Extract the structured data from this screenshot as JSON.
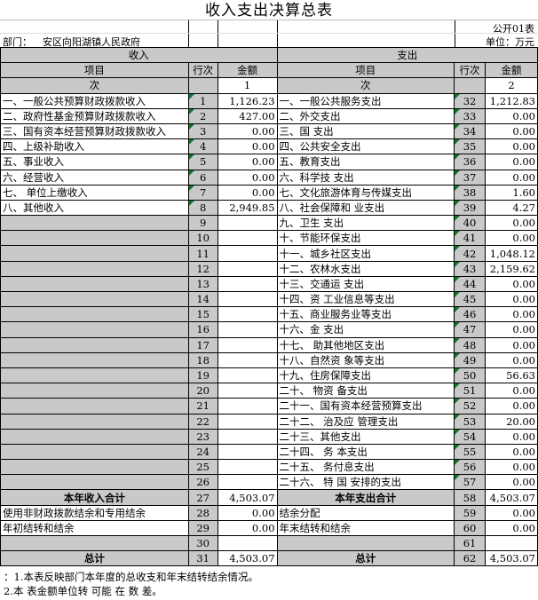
{
  "title": "收入支出决算总表",
  "form_no": "公开01表",
  "department_label": "部门：",
  "department_name": "安区向阳湖镇人民政府",
  "unit_label": "单位：万元",
  "income_header": "收入",
  "expense_header": "支出",
  "col_item": "项目",
  "col_seq": "行次",
  "col_amount": "金额",
  "sub_ci": "次",
  "sub_1": "1",
  "sub_2": "2",
  "income_rows": [
    {
      "label": "一、一般公共预算财政拨款收入",
      "seq": "1",
      "amount": "1,126.23",
      "flag": true
    },
    {
      "label": "二、政府性基金预算财政拨款收入",
      "seq": "2",
      "amount": "427.00",
      "flag": true
    },
    {
      "label": "三、国有资本经营预算财政拨款收入",
      "seq": "3",
      "amount": "0.00",
      "flag": true
    },
    {
      "label": "四、上级补助收入",
      "seq": "4",
      "amount": "0.00",
      "flag": true
    },
    {
      "label": "五、事业收入",
      "seq": "5",
      "amount": "0.00",
      "flag": true
    },
    {
      "label": "六、经营收入",
      "seq": "6",
      "amount": "0.00",
      "flag": true
    },
    {
      "label": "七、    单位上缴收入",
      "seq": "7",
      "amount": "0.00",
      "flag": true
    },
    {
      "label": "八、其他收入",
      "seq": "8",
      "amount": "2,949.85",
      "flag": true
    },
    {
      "label": "",
      "seq": "9",
      "amount": "",
      "flag": false
    },
    {
      "label": "",
      "seq": "10",
      "amount": "",
      "flag": false
    },
    {
      "label": "",
      "seq": "11",
      "amount": "",
      "flag": false
    },
    {
      "label": "",
      "seq": "12",
      "amount": "",
      "flag": false
    },
    {
      "label": "",
      "seq": "13",
      "amount": "",
      "flag": false
    },
    {
      "label": "",
      "seq": "14",
      "amount": "",
      "flag": false
    },
    {
      "label": "",
      "seq": "15",
      "amount": "",
      "flag": false
    },
    {
      "label": "",
      "seq": "16",
      "amount": "",
      "flag": false
    },
    {
      "label": "",
      "seq": "17",
      "amount": "",
      "flag": false
    },
    {
      "label": "",
      "seq": "18",
      "amount": "",
      "flag": false
    },
    {
      "label": "",
      "seq": "19",
      "amount": "",
      "flag": false
    },
    {
      "label": "",
      "seq": "20",
      "amount": "",
      "flag": false
    },
    {
      "label": "",
      "seq": "21",
      "amount": "",
      "flag": false
    },
    {
      "label": "",
      "seq": "22",
      "amount": "",
      "flag": false
    },
    {
      "label": "",
      "seq": "23",
      "amount": "",
      "flag": false
    },
    {
      "label": "",
      "seq": "24",
      "amount": "",
      "flag": false
    },
    {
      "label": "",
      "seq": "25",
      "amount": "",
      "flag": false
    },
    {
      "label": "",
      "seq": "26",
      "amount": "",
      "flag": false
    }
  ],
  "expense_rows": [
    {
      "label": "一、一般公共服务支出",
      "seq": "32",
      "amount": "1,212.83"
    },
    {
      "label": "二、外交支出",
      "seq": "33",
      "amount": "0.00"
    },
    {
      "label": "三、国   支出",
      "seq": "34",
      "amount": "0.00"
    },
    {
      "label": "四、公共安全支出",
      "seq": "35",
      "amount": "0.00"
    },
    {
      "label": "五、教育支出",
      "seq": "36",
      "amount": "0.00"
    },
    {
      "label": "六、科学技   支出",
      "seq": "37",
      "amount": "0.00"
    },
    {
      "label": "七、文化旅游体育与传媒支出",
      "seq": "38",
      "amount": "1.60"
    },
    {
      "label": "八、社会保障和   业支出",
      "seq": "39",
      "amount": "4.27"
    },
    {
      "label": "九、卫生       支出",
      "seq": "40",
      "amount": "0.00"
    },
    {
      "label": "十、节能环保支出",
      "seq": "41",
      "amount": "0.00"
    },
    {
      "label": "十一、城乡社区支出",
      "seq": "42",
      "amount": "1,048.12"
    },
    {
      "label": "十二、农林水支出",
      "seq": "43",
      "amount": "2,159.62"
    },
    {
      "label": "十三、交通运   支出",
      "seq": "44",
      "amount": "0.00"
    },
    {
      "label": "十四、资        工业信息等支出",
      "seq": "45",
      "amount": "0.00"
    },
    {
      "label": "十五、商业服务业等支出",
      "seq": "46",
      "amount": "0.00"
    },
    {
      "label": "十六、金   支出",
      "seq": "47",
      "amount": "0.00"
    },
    {
      "label": "十七、   助其他地区支出",
      "seq": "48",
      "amount": "0.00"
    },
    {
      "label": "十八、自然资        象等支出",
      "seq": "49",
      "amount": "0.00"
    },
    {
      "label": "十九、住房保障支出",
      "seq": "50",
      "amount": "56.63"
    },
    {
      "label": "二十、      物资   备支出",
      "seq": "51",
      "amount": "0.00"
    },
    {
      "label": "二十一、国有资本经营预算支出",
      "seq": "52",
      "amount": "0.00"
    },
    {
      "label": "二十二、       治及应   管理支出",
      "seq": "53",
      "amount": "20.00"
    },
    {
      "label": "二十三、其他支出",
      "seq": "54",
      "amount": "0.00"
    },
    {
      "label": "二十四、    务   本支出",
      "seq": "55",
      "amount": "0.00"
    },
    {
      "label": "二十五、    务付息支出",
      "seq": "56",
      "amount": "0.00"
    },
    {
      "label": "二十六、       特   国   安排的支出",
      "seq": "57",
      "amount": "0.00"
    }
  ],
  "income_total_label": "本年收入合计",
  "income_total_seq": "27",
  "income_total_amount": "4,503.07",
  "expense_total_label": "本年支出合计",
  "expense_total_seq": "58",
  "expense_total_amount": "4,503.07",
  "extra_left": [
    {
      "label": "使用非财政拨款结余和专用结余",
      "seq": "28",
      "amount": "0.00"
    },
    {
      "label": "年初结转和结余",
      "seq": "29",
      "amount": "0.00"
    },
    {
      "label": "",
      "seq": "30",
      "amount": ""
    }
  ],
  "extra_right": [
    {
      "label": "结余分配",
      "seq": "59",
      "amount": "0.00"
    },
    {
      "label": "年末结转和结余",
      "seq": "60",
      "amount": "0.00"
    },
    {
      "label": "",
      "seq": "61",
      "amount": ""
    }
  ],
  "grand_left_label": "总计",
  "grand_left_seq": "31",
  "grand_left_amount": "4,503.07",
  "grand_right_label": "总计",
  "grand_right_seq": "62",
  "grand_right_amount": "4,503.07",
  "note1": "：1.本表反映部门本年度的总收支和年末结转结余情况。",
  "note2": "  2.本     表金额单位转      可能    在    数    差。"
}
